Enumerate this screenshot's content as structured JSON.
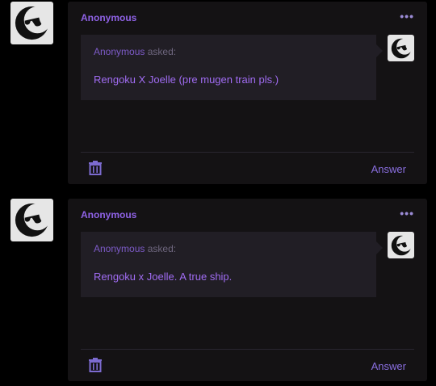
{
  "posts": [
    {
      "name": "Anonymous",
      "more_label": "•••",
      "asker": "Anonymous",
      "asked_label": "asked:",
      "question": "Rengoku X Joelle (pre mugen train pls.)",
      "answer_label": "Answer",
      "icons": [
        "avatar-icon",
        "more-icon",
        "trash-icon"
      ]
    },
    {
      "name": "Anonymous",
      "more_label": "•••",
      "asker": "Anonymous",
      "asked_label": "asked:",
      "question": "Rengoku x Joelle. A true ship.",
      "answer_label": "Answer",
      "icons": [
        "avatar-icon",
        "more-icon",
        "trash-icon"
      ]
    }
  ],
  "colors": {
    "background": "#000000",
    "card": "#141214",
    "ask_box": "#211e25",
    "accent": "#8f62e6",
    "question_text": "#a06cf2"
  }
}
